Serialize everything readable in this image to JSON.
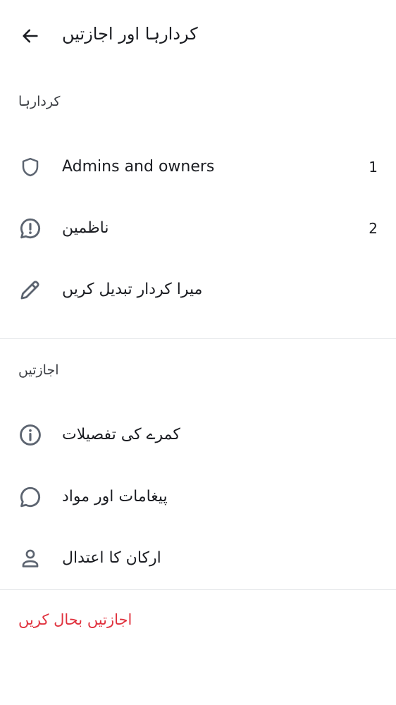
{
  "header": {
    "title": "کردارہا اور اجازتیں",
    "back_icon": "arrow-left-icon"
  },
  "roles_section": {
    "label": "کردارہا",
    "items": [
      {
        "label": "Admins and owners",
        "count": "1",
        "icon": "shield-icon"
      },
      {
        "label": "ناظمین",
        "count": "2",
        "icon": "alert-bubble-icon"
      },
      {
        "label": "میرا کردار تبدیل کریں",
        "icon": "pencil-icon"
      }
    ]
  },
  "permissions_section": {
    "label": "اجازتیں",
    "items": [
      {
        "label": "کمرے کی تفصیلات",
        "icon": "info-icon"
      },
      {
        "label": "پیغامات اور مواد",
        "icon": "chat-bubble-icon"
      },
      {
        "label": "ارکان کا اعتدال",
        "icon": "user-icon"
      }
    ]
  },
  "reset_label": "اجازتیں بحال کریں",
  "colors": {
    "icon": "#5c6470",
    "danger": "#e0323e",
    "divider": "#e3e5e8",
    "text": "#1b1d22"
  }
}
